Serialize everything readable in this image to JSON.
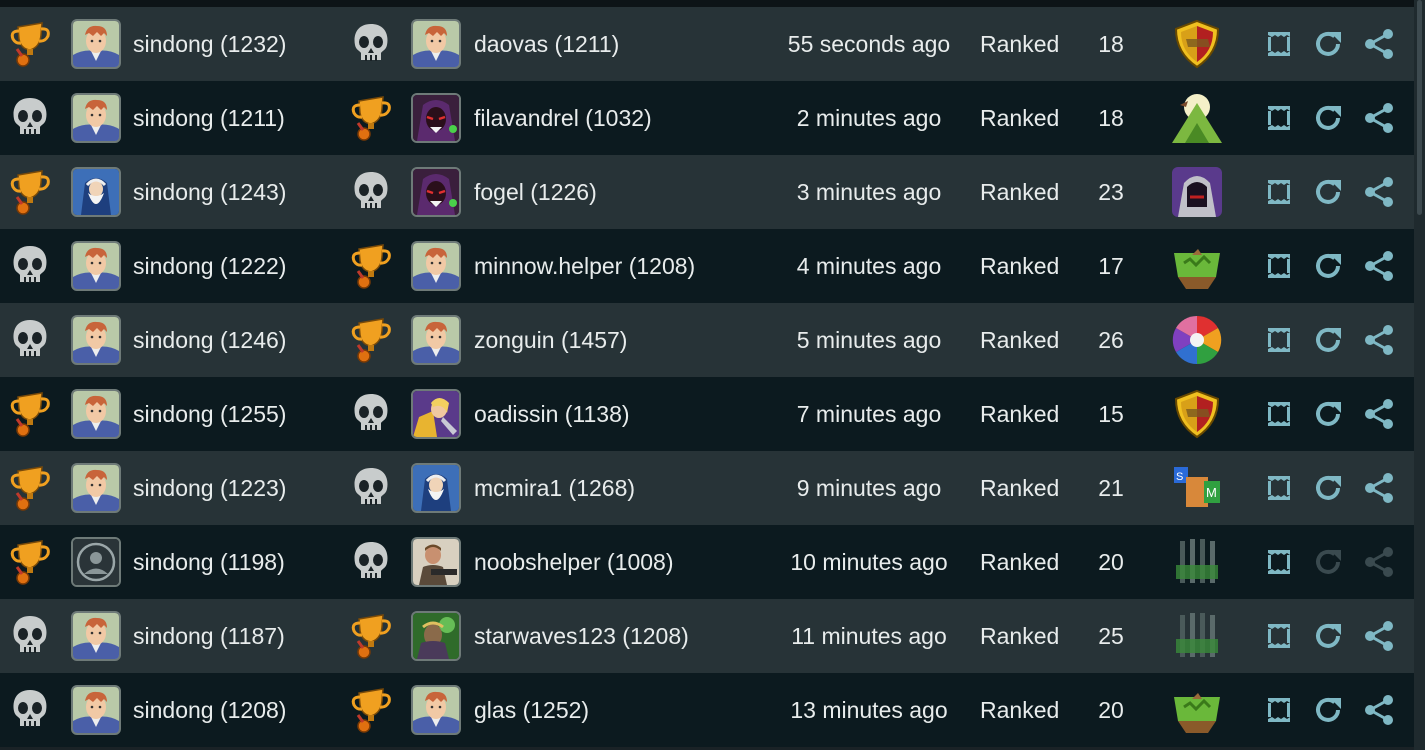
{
  "colors": {
    "row_odd": "#273337",
    "row_even": "#0c1a1f",
    "text": "#e8ecec",
    "action_icon": "#7fb8c4",
    "action_icon_disabled": "#3a4a4f",
    "trophy": "#f0a020",
    "skull": "#c8cccc"
  },
  "matches": [
    {
      "p1_result": "trophy-icon",
      "p1_avatar": "knight",
      "p1_name": "sindong (1232)",
      "p2_result": "skull-icon",
      "p2_avatar": "knight",
      "p2_name": "daovas (1211)",
      "time": "55 seconds ago",
      "type": "Ranked",
      "rounds": "18",
      "deck": "shield",
      "replay_enabled": true
    },
    {
      "p1_result": "skull-icon",
      "p1_avatar": "knight",
      "p1_name": "sindong (1211)",
      "p2_result": "trophy-icon",
      "p2_avatar": "sorcerer",
      "p2_name": "filavandrel (1032)",
      "time": "2 minutes ago",
      "type": "Ranked",
      "rounds": "18",
      "deck": "mountain",
      "replay_enabled": true
    },
    {
      "p1_result": "trophy-icon",
      "p1_avatar": "wizard",
      "p1_name": "sindong (1243)",
      "p2_result": "skull-icon",
      "p2_avatar": "sorcerer",
      "p2_name": "fogel (1226)",
      "time": "3 minutes ago",
      "type": "Ranked",
      "rounds": "23",
      "deck": "hood",
      "replay_enabled": true
    },
    {
      "p1_result": "skull-icon",
      "p1_avatar": "knight",
      "p1_name": "sindong (1222)",
      "p2_result": "trophy-icon",
      "p2_avatar": "knight",
      "p2_name": "minnow.helper (1208)",
      "time": "4 minutes ago",
      "type": "Ranked",
      "rounds": "17",
      "deck": "land",
      "replay_enabled": true
    },
    {
      "p1_result": "skull-icon",
      "p1_avatar": "knight",
      "p1_name": "sindong (1246)",
      "p2_result": "trophy-icon",
      "p2_avatar": "knight",
      "p2_name": "zonguin (1457)",
      "time": "5 minutes ago",
      "type": "Ranked",
      "rounds": "26",
      "deck": "wheel",
      "replay_enabled": true
    },
    {
      "p1_result": "trophy-icon",
      "p1_avatar": "knight",
      "p1_name": "sindong (1255)",
      "p2_result": "skull-icon",
      "p2_avatar": "paladin",
      "p2_name": "oadissin (1138)",
      "time": "7 minutes ago",
      "type": "Ranked",
      "rounds": "15",
      "deck": "shield",
      "replay_enabled": true
    },
    {
      "p1_result": "trophy-icon",
      "p1_avatar": "knight",
      "p1_name": "sindong (1223)",
      "p2_result": "skull-icon",
      "p2_avatar": "wizard",
      "p2_name": "mcmira1 (1268)",
      "time": "9 minutes ago",
      "type": "Ranked",
      "rounds": "21",
      "deck": "blocks",
      "replay_enabled": true
    },
    {
      "p1_result": "trophy-icon",
      "p1_avatar": "default",
      "p1_name": "sindong (1198)",
      "p2_result": "skull-icon",
      "p2_avatar": "gunner",
      "p2_name": "noobshelper (1008)",
      "time": "10 minutes ago",
      "type": "Ranked",
      "rounds": "20",
      "deck": "bars",
      "replay_enabled": false
    },
    {
      "p1_result": "skull-icon",
      "p1_avatar": "knight",
      "p1_name": "sindong (1187)",
      "p2_result": "trophy-icon",
      "p2_avatar": "goblin",
      "p2_name": "starwaves123 (1208)",
      "time": "11 minutes ago",
      "type": "Ranked",
      "rounds": "25",
      "deck": "bars",
      "replay_enabled": true
    },
    {
      "p1_result": "skull-icon",
      "p1_avatar": "knight",
      "p1_name": "sindong (1208)",
      "p2_result": "trophy-icon",
      "p2_avatar": "knight",
      "p2_name": "glas (1252)",
      "time": "13 minutes ago",
      "type": "Ranked",
      "rounds": "20",
      "deck": "land",
      "replay_enabled": true
    }
  ]
}
